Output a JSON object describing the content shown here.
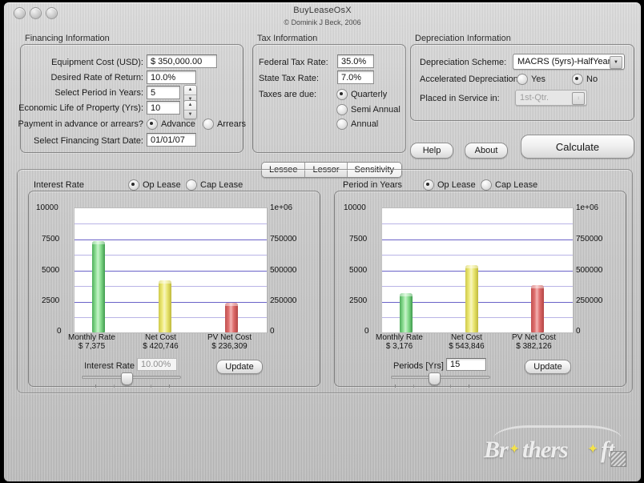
{
  "window": {
    "title": "BuyLeaseOsX",
    "copyright": "© Dominik J Beck, 2006",
    "traffic_lights": [
      "close-button",
      "minimize-button",
      "zoom-button"
    ]
  },
  "financing": {
    "group_label": "Financing Information",
    "fields": [
      {
        "label": "Equipment Cost (USD):",
        "value": "$ 350,000.00"
      },
      {
        "label": "Desired Rate of Return:",
        "value": "10.0%"
      },
      {
        "label": "Select Period in Years:",
        "value": "5"
      },
      {
        "label": "Economic Life of Property (Yrs):",
        "value": "10"
      },
      {
        "label": "Select Financing Start Date:",
        "value": "01/01/07"
      }
    ],
    "payment_label": "Payment in advance or arrears?",
    "payment_options": [
      {
        "label": "Advance",
        "selected": true
      },
      {
        "label": "Arrears",
        "selected": false
      }
    ]
  },
  "tax": {
    "group_label": "Tax Information",
    "federal_label": "Federal Tax Rate:",
    "federal_value": "35.0%",
    "state_label": "State Tax Rate:",
    "state_value": "7.0%",
    "due_label": "Taxes are due:",
    "due_options": [
      {
        "label": "Quarterly",
        "selected": true
      },
      {
        "label": "Semi Annual",
        "selected": false
      },
      {
        "label": "Annual",
        "selected": false
      }
    ]
  },
  "depreciation": {
    "group_label": "Depreciation Information",
    "scheme_label": "Depreciation Scheme:",
    "scheme_value": "MACRS (5yrs)-HalfYear",
    "accelerated_label": "Accelerated Depreciation:",
    "accelerated_options": [
      {
        "label": "Yes",
        "selected": false
      },
      {
        "label": "No",
        "selected": true
      }
    ],
    "service_label": "Placed in Service in:",
    "service_value": "1st-Qtr.",
    "service_disabled": true
  },
  "actions": {
    "help": "Help",
    "about": "About",
    "calculate": "Calculate"
  },
  "tabs": [
    {
      "label": "Lessee",
      "active": false
    },
    {
      "label": "Lessor",
      "active": false
    },
    {
      "label": "Sensitivity",
      "active": true
    }
  ],
  "panels": [
    {
      "title": "Interest Rate",
      "lease_options": [
        {
          "label": "Op Lease",
          "selected": true
        },
        {
          "label": "Cap Lease",
          "selected": false
        }
      ],
      "slider_label": "Interest Rate",
      "slider_value": "10.00%",
      "slider_value_disabled": true,
      "slider_position_pct": 45,
      "update_label": "Update"
    },
    {
      "title": "Period in Years",
      "lease_options": [
        {
          "label": "Op Lease",
          "selected": true
        },
        {
          "label": "Cap Lease",
          "selected": false
        }
      ],
      "slider_label": "Periods [Yrs]",
      "slider_value": "15",
      "slider_value_disabled": false,
      "slider_position_pct": 43,
      "update_label": "Update"
    }
  ],
  "chart_data": [
    {
      "type": "bar",
      "title": "Interest Rate",
      "categories": [
        "Monthly Rate",
        "Net Cost",
        "PV Net Cost"
      ],
      "value_labels": [
        "$ 7,375",
        "$ 420,746",
        "$ 236,309"
      ],
      "values": [
        7375,
        4207,
        2363
      ],
      "left_axis_values": [
        7375,
        4207,
        2363
      ],
      "right_axis_values": [
        737500,
        420746,
        236309
      ],
      "colors": [
        "#7ad47f",
        "#eeea78",
        "#e0706f"
      ],
      "ylabel": "",
      "xlabel": "",
      "ylim": [
        0,
        10000
      ],
      "ylim_right": [
        0,
        1000000
      ],
      "yticks": [
        0,
        2500,
        5000,
        7500,
        10000
      ],
      "ytick_labels": [
        "0",
        "2500",
        "5000",
        "7500",
        "10000"
      ],
      "ytick_labels_right": [
        "0",
        "250000",
        "500000",
        "750000",
        "1e+06"
      ],
      "grid": true,
      "legend": "none"
    },
    {
      "type": "bar",
      "title": "Period in Years",
      "categories": [
        "Monthly Rate",
        "Net Cost",
        "PV Net Cost"
      ],
      "value_labels": [
        "$ 3,176",
        "$ 543,846",
        "$ 382,126"
      ],
      "values": [
        3176,
        5438,
        3821
      ],
      "left_axis_values": [
        3176,
        5438,
        3821
      ],
      "right_axis_values": [
        317600,
        543846,
        382126
      ],
      "colors": [
        "#7ad47f",
        "#eeea78",
        "#e0706f"
      ],
      "ylabel": "",
      "xlabel": "",
      "ylim": [
        0,
        10000
      ],
      "ylim_right": [
        0,
        1000000
      ],
      "yticks": [
        0,
        2500,
        5000,
        7500,
        10000
      ],
      "ytick_labels": [
        "0",
        "2500",
        "5000",
        "7500",
        "10000"
      ],
      "ytick_labels_right": [
        "0",
        "250000",
        "500000",
        "750000",
        "1e+06"
      ],
      "grid": true,
      "legend": "none"
    }
  ],
  "watermark": {
    "text_1": "Br",
    "text_2": "thers",
    "text_3": "ft",
    "full": "Brothersoft"
  }
}
